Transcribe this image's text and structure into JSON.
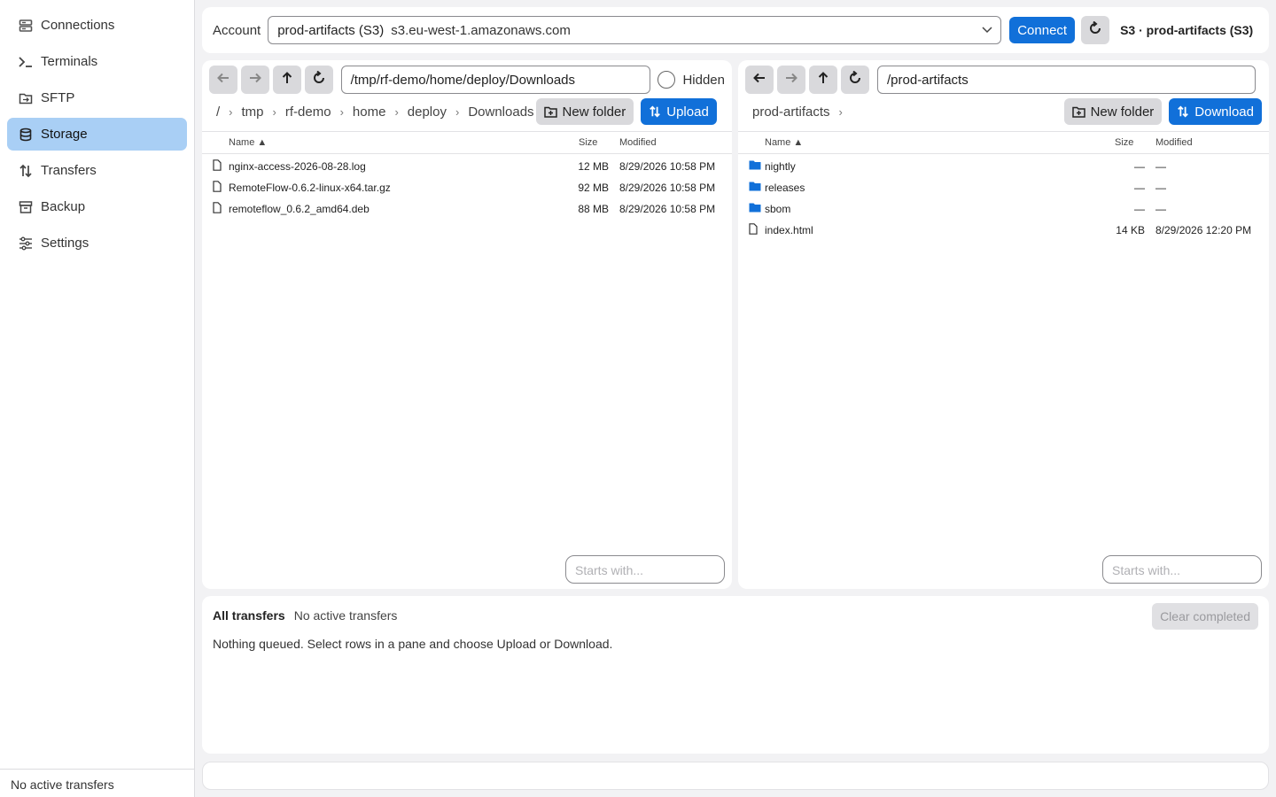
{
  "sidebar": {
    "items": [
      {
        "label": "Connections",
        "icon": "server-stack-icon"
      },
      {
        "label": "Terminals",
        "icon": "terminal-prompt-icon"
      },
      {
        "label": "SFTP",
        "icon": "folder-transfer-icon"
      },
      {
        "label": "Storage",
        "icon": "database-icon",
        "active": true
      },
      {
        "label": "Transfers",
        "icon": "up-down-arrows-icon"
      },
      {
        "label": "Backup",
        "icon": "archive-box-icon"
      },
      {
        "label": "Settings",
        "icon": "sliders-icon"
      }
    ],
    "status": "No active transfers"
  },
  "topbar": {
    "account_label": "Account",
    "account_name": "prod-artifacts (S3)",
    "account_host": "s3.eu-west-1.amazonaws.com",
    "connect_label": "Connect",
    "connection_title": "S3 · prod-artifacts (S3)"
  },
  "left_pane": {
    "path": "/tmp/rf-demo/home/deploy/Downloads",
    "hidden_label": "Hidden",
    "breadcrumbs": [
      "/",
      "tmp",
      "rf-demo",
      "home",
      "deploy",
      "Downloads"
    ],
    "new_folder_label": "New folder",
    "action_label": "Upload",
    "columns": {
      "name": "Name ▲",
      "size": "Size",
      "modified": "Modified"
    },
    "rows": [
      {
        "type": "file",
        "name": "nginx-access-2026-08-28.log",
        "size": "12 MB",
        "modified": "8/29/2026 10:58 PM"
      },
      {
        "type": "file",
        "name": "RemoteFlow-0.6.2-linux-x64.tar.gz",
        "size": "92 MB",
        "modified": "8/29/2026 10:58 PM"
      },
      {
        "type": "file",
        "name": "remoteflow_0.6.2_amd64.deb",
        "size": "88 MB",
        "modified": "8/29/2026 10:58 PM"
      }
    ],
    "filter_placeholder": "Starts with..."
  },
  "right_pane": {
    "path": "/prod-artifacts",
    "breadcrumbs": [
      "prod-artifacts"
    ],
    "new_folder_label": "New folder",
    "action_label": "Download",
    "columns": {
      "name": "Name ▲",
      "size": "Size",
      "modified": "Modified"
    },
    "rows": [
      {
        "type": "folder",
        "name": "nightly",
        "size": "—",
        "modified": "—"
      },
      {
        "type": "folder",
        "name": "releases",
        "size": "—",
        "modified": "—"
      },
      {
        "type": "folder",
        "name": "sbom",
        "size": "—",
        "modified": "—"
      },
      {
        "type": "file",
        "name": "index.html",
        "size": "14 KB",
        "modified": "8/29/2026 12:20 PM"
      }
    ],
    "filter_placeholder": "Starts with..."
  },
  "transfers": {
    "title": "All transfers",
    "status": "No active transfers",
    "clear_label": "Clear completed",
    "empty_message": "Nothing queued. Select rows in a pane and choose Upload or Download."
  },
  "colors": {
    "accent": "#1170d9",
    "active_nav": "#a9cff5",
    "folder": "#1170d9"
  }
}
